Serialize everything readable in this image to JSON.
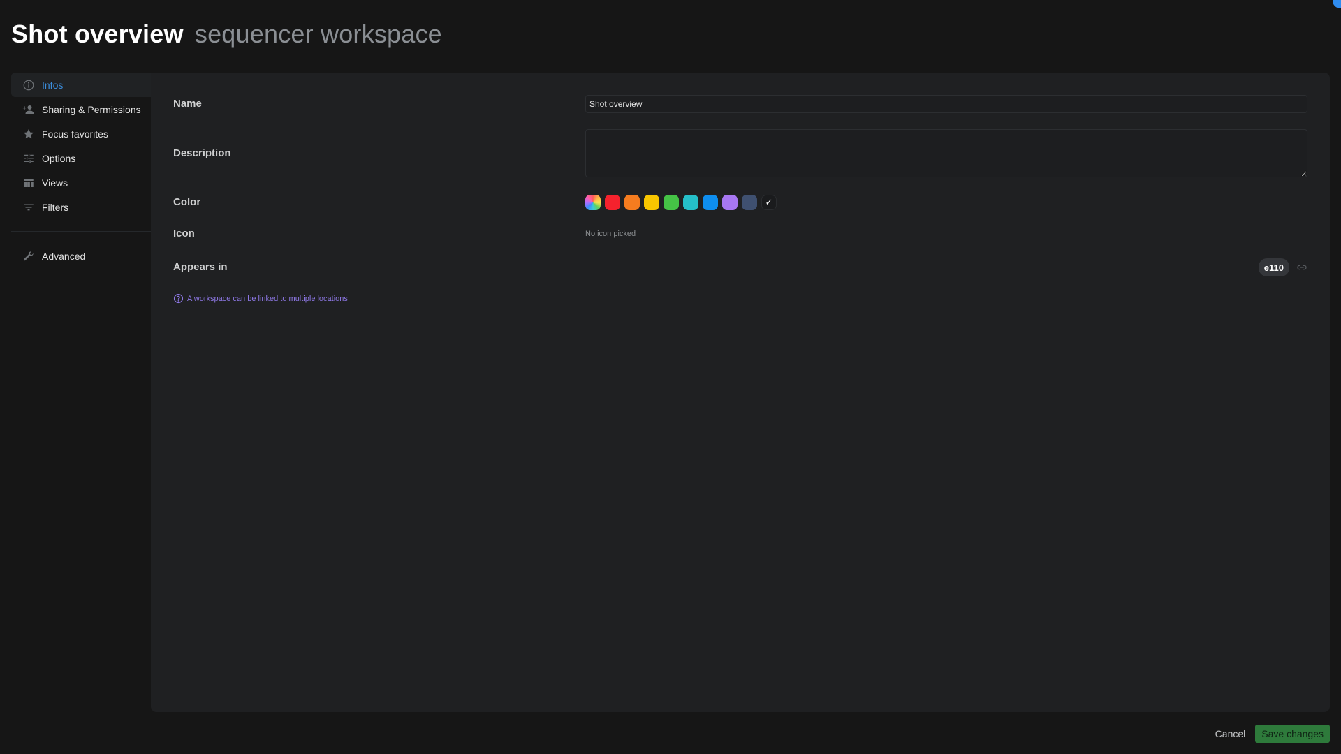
{
  "header": {
    "title": "Shot overview",
    "subtitle": "sequencer workspace"
  },
  "sidebar": {
    "items": [
      {
        "label": "Infos",
        "icon": "info-icon",
        "active": true
      },
      {
        "label": "Sharing & Permissions",
        "icon": "add-person-icon",
        "active": false
      },
      {
        "label": "Focus favorites",
        "icon": "star-icon",
        "active": false
      },
      {
        "label": "Options",
        "icon": "sliders-icon",
        "active": false
      },
      {
        "label": "Views",
        "icon": "table-icon",
        "active": false
      },
      {
        "label": "Filters",
        "icon": "filter-icon",
        "active": false
      }
    ],
    "advanced": {
      "label": "Advanced",
      "icon": "wrench-icon"
    }
  },
  "form": {
    "name": {
      "label": "Name",
      "value": "Shot overview",
      "placeholder": ""
    },
    "description": {
      "label": "Description",
      "value": "",
      "placeholder": ""
    },
    "color": {
      "label": "Color",
      "swatches": [
        {
          "name": "multicolor",
          "hex": "conic"
        },
        {
          "name": "red",
          "hex": "#f5222d"
        },
        {
          "name": "orange",
          "hex": "#f57c1f"
        },
        {
          "name": "yellow",
          "hex": "#f8c600"
        },
        {
          "name": "green",
          "hex": "#45c346"
        },
        {
          "name": "teal",
          "hex": "#25bfc9"
        },
        {
          "name": "blue",
          "hex": "#0e8ef0"
        },
        {
          "name": "purple",
          "hex": "#a777f2"
        },
        {
          "name": "slate",
          "hex": "#3f5070"
        },
        {
          "name": "none",
          "hex": "",
          "selected": true
        }
      ],
      "check_glyph": "✓"
    },
    "icon": {
      "label": "Icon",
      "empty_text": "No icon picked"
    },
    "appears_in": {
      "label": "Appears in",
      "locations": [
        "e110"
      ],
      "help_text": "A workspace can be linked to multiple locations"
    }
  },
  "footer": {
    "cancel_label": "Cancel",
    "save_label": "Save changes"
  },
  "colors": {
    "accent": "#3b8ede",
    "save": "#2e7a3b",
    "help": "#8e78e6"
  }
}
